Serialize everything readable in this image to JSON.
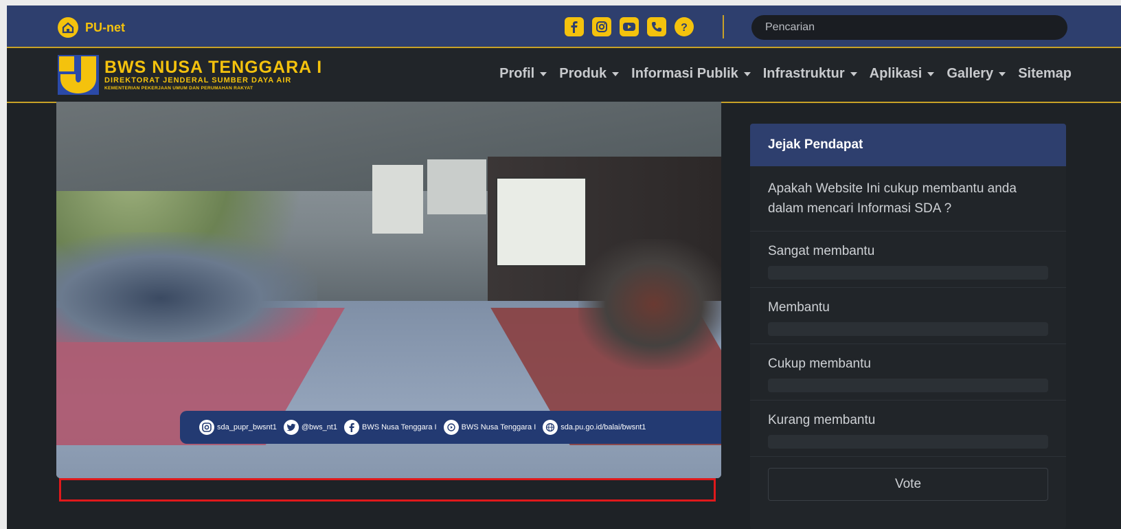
{
  "topbar": {
    "brand": "PU-net",
    "social_icons": [
      "facebook-icon",
      "instagram-icon",
      "youtube-icon",
      "phone-icon",
      "help-icon"
    ],
    "search_placeholder": "Pencarian"
  },
  "navbar": {
    "logo_title": "BWS NUSA TENGGARA I",
    "logo_subtitle": "DIREKTORAT JENDERAL SUMBER DAYA AIR",
    "logo_subtitle2": "KEMENTERIAN PEKERJAAN UMUM DAN PERUMAHAN RAKYAT",
    "menu": [
      {
        "label": "Profil",
        "dropdown": true
      },
      {
        "label": "Produk",
        "dropdown": true
      },
      {
        "label": "Informasi Publik",
        "dropdown": true
      },
      {
        "label": "Infrastruktur",
        "dropdown": true
      },
      {
        "label": "Aplikasi",
        "dropdown": true
      },
      {
        "label": "Gallery",
        "dropdown": true
      },
      {
        "label": "Sitemap",
        "dropdown": false
      }
    ]
  },
  "photo_overlay": {
    "instagram": "sda_pupr_bwsnt1",
    "twitter": "@bws_nt1",
    "facebook": "BWS Nusa Tenggara I",
    "youtube": "BWS Nusa Tenggara I",
    "website": "sda.pu.go.id/balai/bwsnt1"
  },
  "caption": "",
  "poll": {
    "title": "Jejak Pendapat",
    "question": "Apakah Website Ini cukup membantu anda dalam mencari Informasi SDA ?",
    "options": [
      {
        "label": "Sangat membantu",
        "percent": 0
      },
      {
        "label": "Membantu",
        "percent": 0
      },
      {
        "label": "Cukup membantu",
        "percent": 0
      },
      {
        "label": "Kurang membantu",
        "percent": 0
      }
    ],
    "vote_label": "Vote"
  },
  "colors": {
    "accent": "#f4c20d",
    "header_blue": "#2e3f6e",
    "background": "#1e2226",
    "highlight": "#e0191b"
  }
}
